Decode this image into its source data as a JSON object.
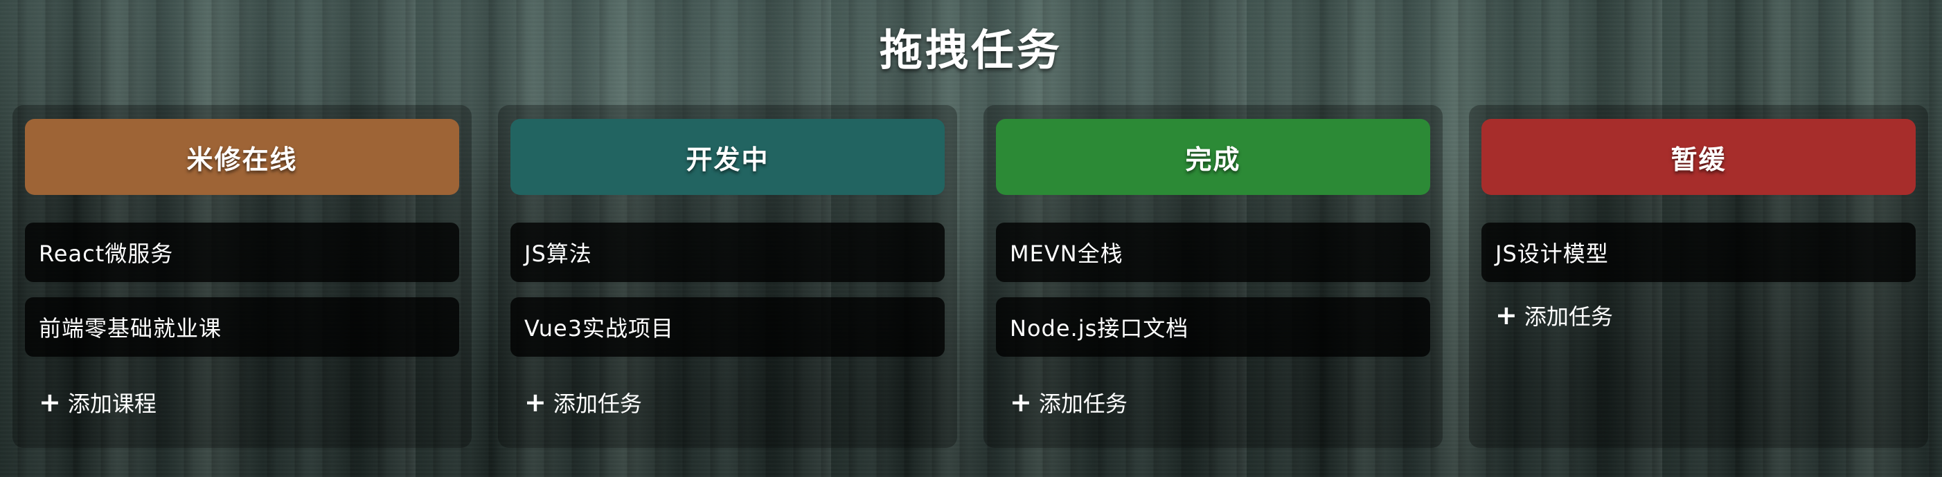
{
  "title": "拖拽任务",
  "columns": [
    {
      "name": "米修在线",
      "color": "#9e6436",
      "cards": [
        "React微服务",
        "前端零基础就业课"
      ],
      "add_label": "添加课程"
    },
    {
      "name": "开发中",
      "color": "#226461",
      "cards": [
        "JS算法",
        "Vue3实战项目"
      ],
      "add_label": "添加任务"
    },
    {
      "name": "完成",
      "color": "#2c8a36",
      "cards": [
        "MEVN全栈",
        "Node.js接口文档"
      ],
      "add_label": "添加任务"
    },
    {
      "name": "暂缓",
      "color": "#a72d2b",
      "cards": [
        "JS设计模型"
      ],
      "add_label": "添加任务"
    }
  ],
  "icons": {
    "add": "plus-icon"
  }
}
